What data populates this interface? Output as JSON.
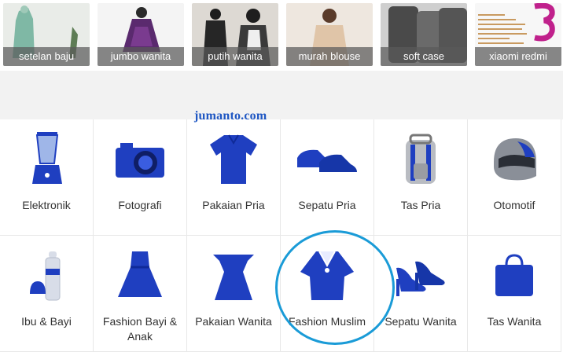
{
  "search_thumbs": [
    {
      "label": "setelan baju"
    },
    {
      "label": "jumbo wanita"
    },
    {
      "label": "putih wanita"
    },
    {
      "label": "murah blouse"
    },
    {
      "label": "soft case"
    },
    {
      "label": "xiaomi redmi"
    }
  ],
  "watermark": "jumanto.com",
  "categories": [
    {
      "label": "Elektronik",
      "icon": "blender-icon"
    },
    {
      "label": "Fotografi",
      "icon": "camera-icon"
    },
    {
      "label": "Pakaian Pria",
      "icon": "polo-shirt-icon"
    },
    {
      "label": "Sepatu Pria",
      "icon": "men-shoes-icon"
    },
    {
      "label": "Tas Pria",
      "icon": "backpack-icon"
    },
    {
      "label": "Otomotif",
      "icon": "helmet-icon"
    },
    {
      "label": "Ibu & Bayi",
      "icon": "baby-bottle-icon"
    },
    {
      "label": "Fashion Bayi & Anak",
      "icon": "kids-dress-icon"
    },
    {
      "label": "Pakaian Wanita",
      "icon": "women-dress-icon"
    },
    {
      "label": "Fashion Muslim",
      "icon": "kaftan-icon"
    },
    {
      "label": "Sepatu Wanita",
      "icon": "heels-icon"
    },
    {
      "label": "Tas Wanita",
      "icon": "handbag-icon"
    }
  ],
  "colors": {
    "accent": "#1f3fc0",
    "highlight": "#1a9bd7",
    "watermark": "#1f57c3"
  }
}
